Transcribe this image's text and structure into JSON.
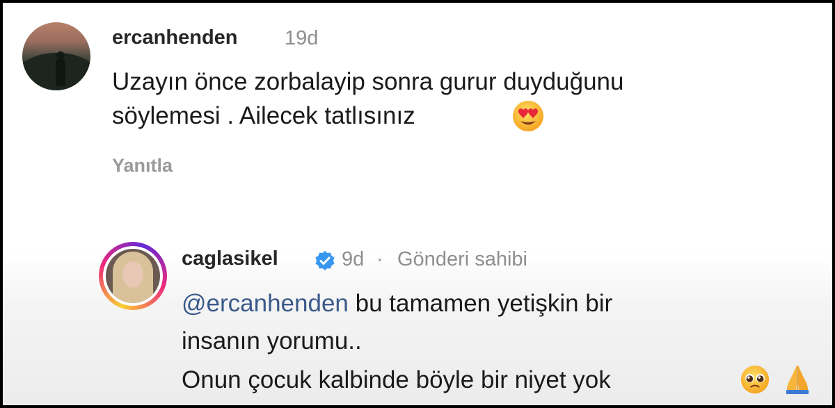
{
  "comment": {
    "username": "ercanhenden",
    "time": "19d",
    "text_line1": "Uzayın önce  zorbalayip sonra gurur duyduğunu",
    "text_line2": "söylemesi . Ailecek tatlısınız",
    "emoji": "heart-eyes-emoji",
    "reply_label": "Yanıtla"
  },
  "reply": {
    "username": "caglasikel",
    "verified": true,
    "time": "9d",
    "separator": "·",
    "owner_label": "Gönderi sahibi",
    "mention": "@ercanhenden",
    "text_line1_rest": " bu tamamen yetişkin bir",
    "text_line2": "insanın yorumu..",
    "text_line3": "Onun çocuk kalbinde böyle bir niyet yok",
    "emojis": [
      "pleading-face-emoji",
      "folded-hands-emoji"
    ]
  },
  "colors": {
    "username": "#262626",
    "meta": "#8e8e8e",
    "mention": "#3a5a8a",
    "verified": "#3897f0"
  }
}
